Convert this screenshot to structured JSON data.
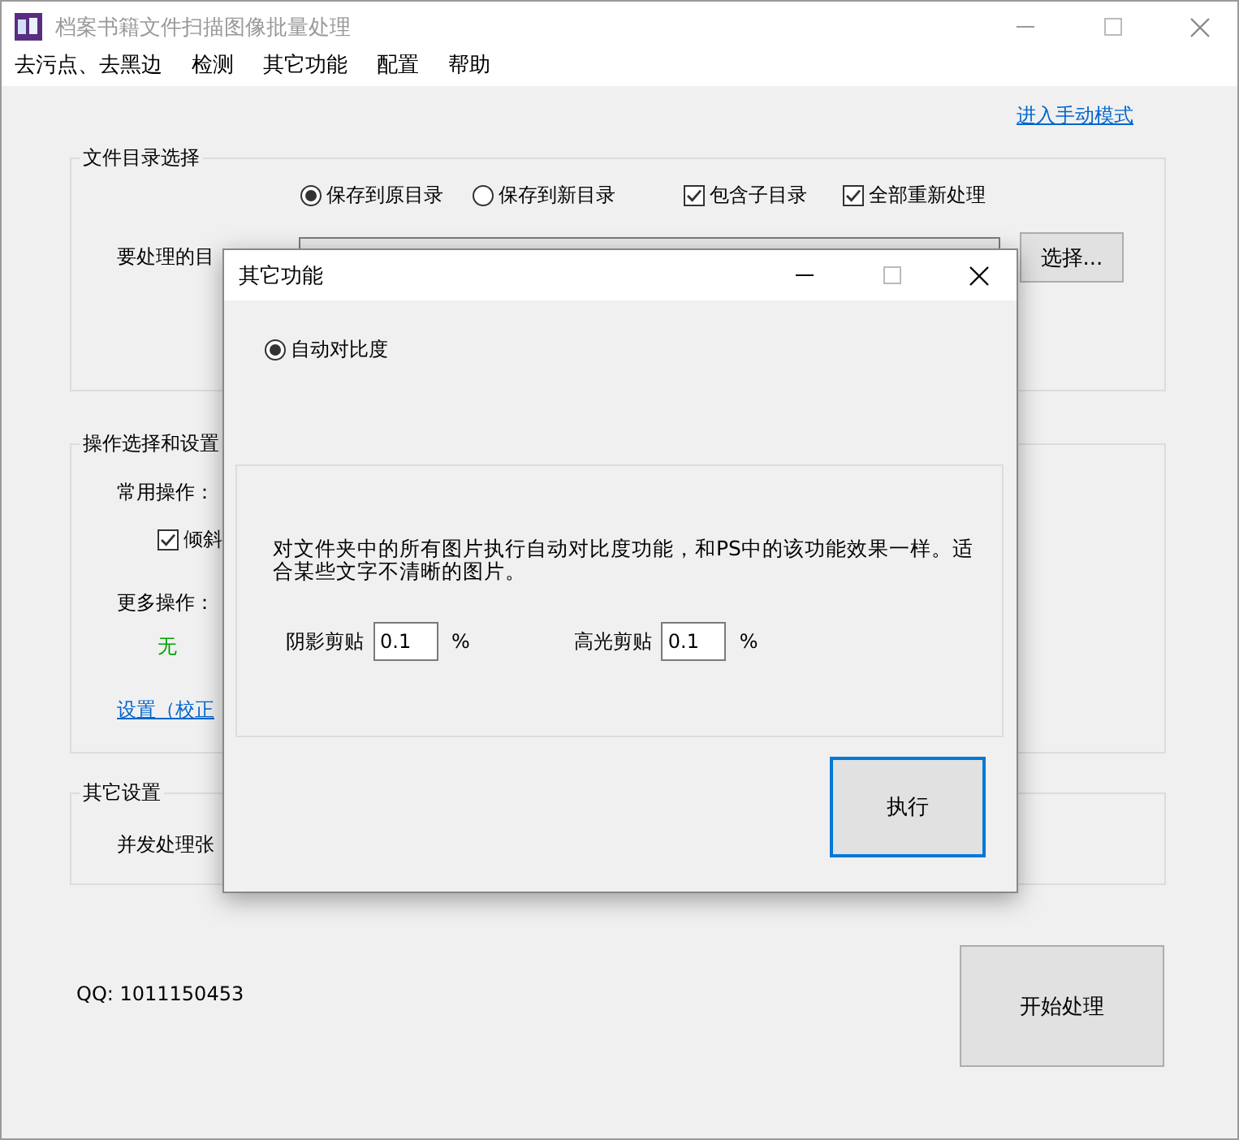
{
  "window": {
    "title": "档案书籍文件扫描图像批量处理"
  },
  "menu": [
    "去污点、去黑边",
    "检测",
    "其它功能",
    "配置",
    "帮助"
  ],
  "manual_mode_link": "进入手动模式",
  "directory_group": {
    "title": "文件目录选择",
    "save_options": [
      {
        "label": "保存到原目录",
        "selected": true
      },
      {
        "label": "保存到新目录",
        "selected": false
      }
    ],
    "checkboxes": [
      {
        "label": "包含子目录",
        "checked": true
      },
      {
        "label": "全部重新处理",
        "checked": true
      }
    ],
    "path_label": "要处理的目",
    "browse_button": "选择..."
  },
  "operations_group": {
    "title": "操作选择和设置",
    "common_label": "常用操作：",
    "common_options": [
      {
        "label": "倾斜",
        "checked": true
      }
    ],
    "more_label": "更多操作：",
    "more_value": "无",
    "settings_link": "设置（校正"
  },
  "other_group": {
    "title": "其它设置",
    "concurrency_label": "并发处理张"
  },
  "qq": "QQ: 1011150453",
  "start_button": "开始处理",
  "dialog": {
    "title": "其它功能",
    "modes": [
      {
        "label": "自动对比度",
        "selected": true
      }
    ],
    "description": "对文件夹中的所有图片执行自动对比度功能，和PS中的该功能效果一样。适合某些文字不清晰的图片。",
    "fields": [
      {
        "label": "阴影剪贴",
        "value": "0.1",
        "unit": "%"
      },
      {
        "label": "高光剪贴",
        "value": "0.1",
        "unit": "%"
      }
    ],
    "execute_button": "执行"
  }
}
